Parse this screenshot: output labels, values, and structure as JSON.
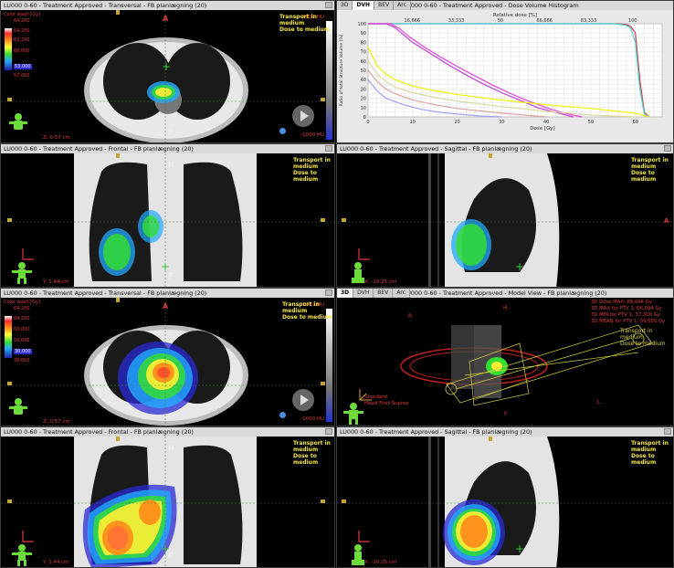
{
  "panel_tl": {
    "title": "LU000 0-60 - Treatment Approved - Transversal - FB planlægning (20)",
    "legend_title": "Color wash [Gy]",
    "cb_labels": [
      "64,200",
      "64,200",
      "63,200",
      "60,000",
      "53,000",
      "57,000"
    ],
    "cb_right_top": "1021 HU",
    "cb_right_bottom": "-1000 HU",
    "overlay_text": [
      "Transport in",
      "medium",
      "Dose to medium"
    ],
    "dir_top": "A",
    "dir_bottom": "P",
    "coord": "Z: 0.57 cm"
  },
  "panel_tr": {
    "tabs": [
      "3D",
      "DVH",
      "BEV",
      "Arc"
    ],
    "active_tab": "DVH",
    "title": "LU000 0-60 - Treatment Approved - Dose Volume Histogram",
    "chart_title": "Relative dose [%]",
    "xlabel": "Dose [Gy]",
    "ylabel": "Ratio of total Structure Volume [%]"
  },
  "panel_ml": {
    "title": "LU000 0-60 - Treatment Approved - Frontal - FB planlægning (20)",
    "overlay_text": [
      "Transport in",
      "medium",
      "Dose to medium"
    ],
    "dir_top": "H",
    "dir_bottom": "F",
    "coord": "Y: 1.44 cm"
  },
  "panel_mr": {
    "title": "LU000 0-60 - Treatment Approved - Sagittal - FB planlægning (20)",
    "overlay_text": [
      "Transport in",
      "medium",
      "Dose to medium"
    ],
    "dir_right": "A",
    "coord": "X: -10.25 cm"
  },
  "panel_bl": {
    "title": "LU000 0-60 - Treatment Approved - Transversal - FB planlægning (20)",
    "legend_title": "Color wash [Gy]",
    "cb_labels": [
      "64,200",
      "64,200",
      "60,000",
      "50,000",
      "30,000",
      "30,000"
    ],
    "cb_right_top": "1021 HU",
    "cb_right_bottom": "-1000 HU",
    "overlay_text": [
      "Transport in",
      "medium",
      "Dose to medium"
    ],
    "dir_top": "A",
    "dir_bottom": "P",
    "coord": "Z: 0.57 cm"
  },
  "panel_br3d": {
    "tabs": [
      "3D",
      "DVH",
      "BEV",
      "Arc"
    ],
    "active_tab": "3D",
    "title": "LU000 0-60 - Treatment Approved - Model View - FB planlægning (20)",
    "stats": [
      "3D Dose MAX: 66,094 Gy",
      "3D MAX for PTV 1: 66,094 Gy",
      "3D MIN for PTV 1: 37,300 Gy",
      "3D MEAN for PTV 1: 59,650 Gy"
    ],
    "overlay_text": [
      "Transport in",
      "medium",
      "Dose to medium"
    ],
    "orientation_label": "Standard",
    "orientation_label2": "Head First-Supine",
    "dir_letters": [
      "R",
      "H",
      "L",
      "F"
    ]
  },
  "panel_bml": {
    "title": "LU000 0-60 - Treatment Approved - Frontal - FB planlægning (20)",
    "overlay_text": [
      "Transport in",
      "medium",
      "Dose to medium"
    ],
    "dir_top": "H",
    "dir_bottom": "F",
    "coord": "Y: 1.44 cm"
  },
  "panel_bmr": {
    "title": "LU000 0-60 - Treatment Approved - Sagittal - FB planlægning (20)",
    "overlay_text": [
      "Transport in",
      "medium",
      "Dose to medium"
    ],
    "coord": "X: -10.25 cm"
  },
  "chart_data": {
    "type": "line",
    "title": "Relative dose [%]",
    "xlabel": "Dose [Gy]",
    "ylabel": "Ratio of total Structure Volume [%]",
    "x_ticks": [
      0,
      10,
      20,
      30,
      40,
      50,
      60
    ],
    "y_ticks": [
      0,
      10,
      20,
      30,
      40,
      50,
      60,
      70,
      80,
      90,
      100
    ],
    "top_ticks": [
      "16,666",
      "33,333",
      "50",
      "66,666",
      "83,333",
      "100"
    ],
    "xlim": [
      0,
      66
    ],
    "ylim": [
      0,
      100
    ],
    "series": [
      {
        "color": "#e0303a",
        "x": [
          0,
          56,
          58,
          59,
          60,
          61,
          62,
          63
        ],
        "y": [
          100,
          100,
          99,
          97,
          90,
          40,
          5,
          0
        ]
      },
      {
        "color": "#40d8d8",
        "x": [
          0,
          55,
          57,
          58,
          59,
          60,
          61,
          62,
          63
        ],
        "y": [
          100,
          100,
          99,
          98,
          95,
          80,
          30,
          3,
          0
        ]
      },
      {
        "color": "#c03ad8",
        "x": [
          0,
          4,
          6,
          8,
          10,
          14,
          18,
          22,
          26,
          30,
          34,
          38,
          42,
          46
        ],
        "y": [
          100,
          100,
          96,
          88,
          80,
          68,
          56,
          45,
          35,
          26,
          18,
          10,
          5,
          0
        ]
      },
      {
        "color": "#e040e0",
        "x": [
          0,
          5,
          7,
          9,
          12,
          16,
          20,
          24,
          28,
          32,
          36,
          40,
          44,
          48
        ],
        "y": [
          100,
          100,
          95,
          87,
          77,
          65,
          54,
          44,
          34,
          25,
          17,
          10,
          4,
          0
        ]
      },
      {
        "color": "#f0f000",
        "x": [
          0,
          2,
          4,
          6,
          10,
          15,
          20,
          30,
          40,
          50,
          60,
          63
        ],
        "y": [
          75,
          55,
          46,
          40,
          33,
          28,
          24,
          18,
          13,
          9,
          4,
          0
        ]
      },
      {
        "color": "#d8d8a0",
        "x": [
          0,
          2,
          4,
          6,
          10,
          15,
          20,
          30,
          40,
          50,
          60
        ],
        "y": [
          60,
          46,
          38,
          32,
          26,
          21,
          17,
          11,
          6,
          2,
          0
        ]
      },
      {
        "color": "#e0a0a0",
        "x": [
          0,
          2,
          4,
          6,
          10,
          15,
          20,
          30,
          40
        ],
        "y": [
          50,
          38,
          30,
          25,
          18,
          13,
          9,
          4,
          0
        ]
      },
      {
        "color": "#a0a0ff",
        "x": [
          0,
          2,
          4,
          8,
          12,
          16,
          20,
          25,
          30
        ],
        "y": [
          40,
          28,
          20,
          13,
          8,
          5,
          3,
          1,
          0
        ]
      }
    ]
  }
}
